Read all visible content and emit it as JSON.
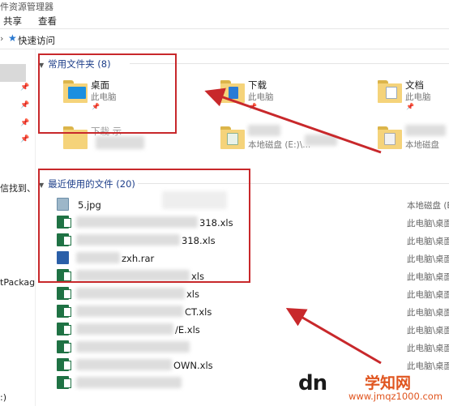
{
  "window": {
    "title_fragment": "件资源管理器"
  },
  "ribbon": {
    "tabs": [
      "共享",
      "查看"
    ]
  },
  "address": {
    "crumb": "快速访问"
  },
  "nav": {
    "items": [
      "信找到、",
      "tPackag",
      ":)"
    ]
  },
  "frequent": {
    "header": "常用文件夹 (8)",
    "folders": [
      {
        "name": "桌面",
        "location": "此电脑"
      },
      {
        "name": "下载",
        "location": "此电脑"
      },
      {
        "name": "文档",
        "location": "此电脑"
      }
    ],
    "partial_row": {
      "left_name": "下栽 示",
      "mid_location": "本地磁盘 (E:)\\...",
      "right_location": "本地磁盘"
    }
  },
  "recent": {
    "header": "最近使用的文件 (20)",
    "files": [
      {
        "type": "jpg",
        "name": "5.jpg",
        "location": "本地磁盘 (E"
      },
      {
        "type": "xls",
        "name": "318.xls",
        "location": "此电脑\\桌面"
      },
      {
        "type": "xls",
        "name": "318.xls",
        "location": "此电脑\\桌面"
      },
      {
        "type": "rar",
        "name": "zxh.rar",
        "location": "此电脑\\桌面"
      },
      {
        "type": "xls",
        "name": "xls",
        "location": "此电脑\\桌面"
      },
      {
        "type": "xls",
        "name": "xls",
        "location": "此电脑\\桌面"
      },
      {
        "type": "xls",
        "name": "CT.xls",
        "location": "此电脑\\桌面"
      },
      {
        "type": "xls",
        "name": "/E.xls",
        "location": "此电脑\\桌面"
      },
      {
        "type": "xls",
        "name": "",
        "location": "此电脑\\桌面"
      },
      {
        "type": "xls",
        "name": "OWN.xls",
        "location": "此电脑\\桌面"
      },
      {
        "type": "xls",
        "name": "",
        "location": ""
      }
    ]
  },
  "watermark": {
    "logo": "dn",
    "site_name": "学知网",
    "url": "www.jmqz1000.com"
  },
  "colors": {
    "annotation_red": "#c8282b",
    "header_blue": "#1e3f8a",
    "folder_yellow": "#f5d37a",
    "excel_green": "#1f7244"
  }
}
